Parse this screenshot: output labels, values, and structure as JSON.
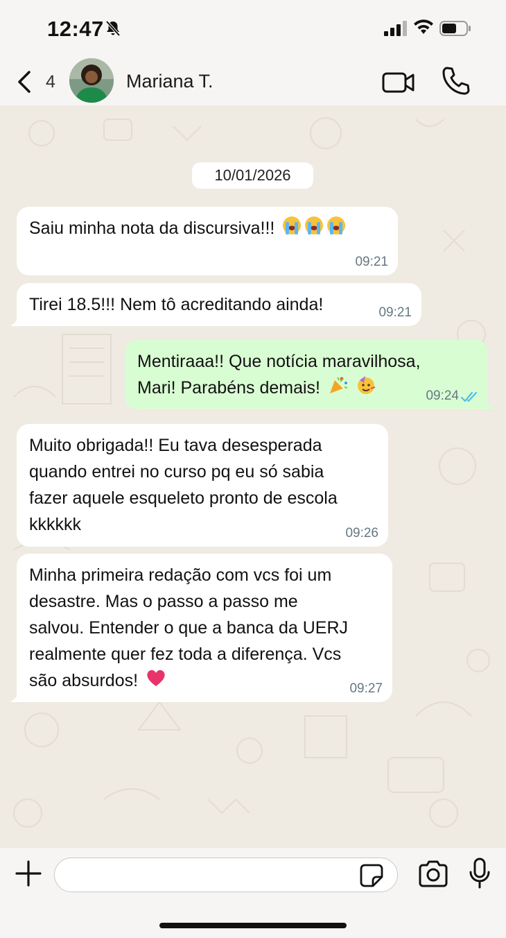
{
  "status_bar": {
    "time": "12:47"
  },
  "header": {
    "back_count": "4",
    "contact_name": "Mariana T."
  },
  "date_chip": "10/01/2026",
  "messages": [
    {
      "direction": "in",
      "text": "Saiu minha nota da discursiva!!! ",
      "emojis": [
        "crying-face",
        "crying-face",
        "crying-face"
      ],
      "time": "09:21"
    },
    {
      "direction": "in",
      "text": "Tirei 18.5!!! Nem tô acreditando ainda!",
      "time": "09:21"
    },
    {
      "direction": "out",
      "text": "Mentiraaa!! Que notícia maravilhosa,\nMari! Parabéns demais! ",
      "emojis": [
        "party-popper",
        "partying-face"
      ],
      "time": "09:24",
      "status": "read"
    },
    {
      "direction": "in",
      "text": "Muito obrigada!! Eu tava desesperada\nquando entrei no curso pq eu só sabia\nfazer aquele esqueleto pronto de escola\nkkkkkk",
      "time": "09:26"
    },
    {
      "direction": "in",
      "text": "Minha primeira redação com vcs foi um\ndesastre. Mas o passo a passo me\nsalvou. Entender o que a banca da UERJ\nrealmente quer fez toda a diferença. Vcs\nsão absurdos! ",
      "emojis": [
        "heart"
      ],
      "time": "09:27"
    }
  ],
  "input": {
    "placeholder": ""
  },
  "colors": {
    "incoming_bubble": "#ffffff",
    "outgoing_bubble": "#d9fdd3",
    "read_ticks": "#53bdeb",
    "wallpaper": "#efeae2"
  }
}
